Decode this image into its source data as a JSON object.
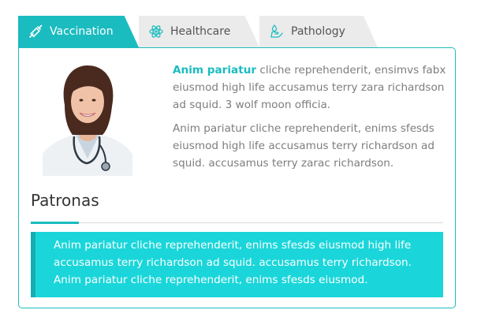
{
  "tabs": [
    {
      "label": "Vaccination",
      "icon": "syringe-icon",
      "active": true
    },
    {
      "label": "Healthcare",
      "icon": "atom-icon",
      "active": false
    },
    {
      "label": "Pathology",
      "icon": "drop-hand-icon",
      "active": false
    }
  ],
  "content": {
    "lead": "Anim pariatur",
    "paragraph1_rest": " cliche reprehenderit, ensimvs fabx eiusmod high life accusamus terry zara richardson ad squid. 3 wolf moon officia.",
    "paragraph2": "Anim pariatur cliche reprehenderit, enims sfesds eiusmod high life accusamus terry richardson ad squid. accusamus terry zarac richardson."
  },
  "section": {
    "title": "Patronas",
    "quote": "Anim pariatur cliche reprehenderit, enims sfesds eiusmod high life accusamus terry richardson ad squid. accusamus terry richardson. Anim pariatur cliche reprehenderit, enims sfesds eiusmod."
  },
  "colors": {
    "accent": "#1bbcc0",
    "quote_bg": "#1ad6da",
    "quote_border": "#13aeb2",
    "inactive_tab": "#ebebeb"
  }
}
